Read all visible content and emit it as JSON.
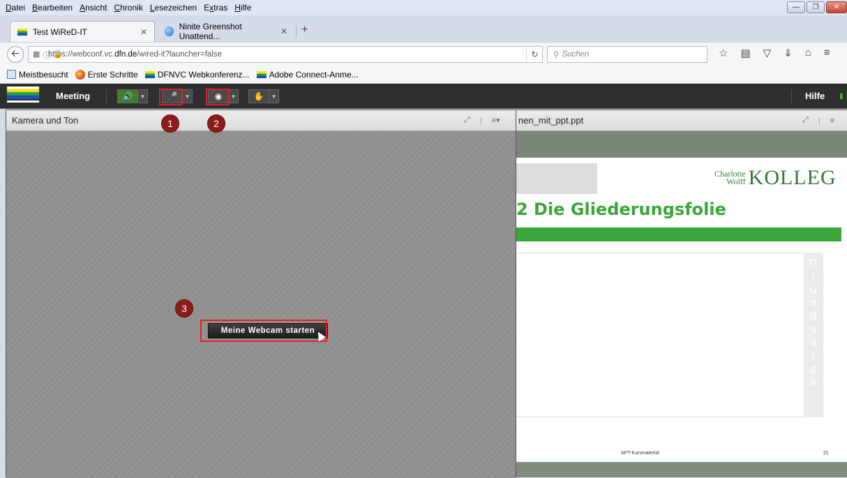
{
  "menu": {
    "items": [
      "Datei",
      "Bearbeiten",
      "Ansicht",
      "Chronik",
      "Lesezeichen",
      "Extras",
      "Hilfe"
    ],
    "accel": [
      "D",
      "B",
      "A",
      "C",
      "L",
      "x",
      "H"
    ]
  },
  "tabs": [
    {
      "label": "Test WiReD-IT",
      "active": true
    },
    {
      "label": "Ninite Greenshot Unattend...",
      "active": false
    }
  ],
  "nav": {
    "url_prefix": "https://webconf.vc.",
    "url_domain": "dfn.de",
    "url_suffix": "/wired-it?launcher=false",
    "search_placeholder": "Suchen"
  },
  "bookmarks": [
    "Meistbesucht",
    "Erste Schritte",
    "DFNVC Webkonferenz...",
    "Adobe Connect-Anme..."
  ],
  "appbar": {
    "meeting_label": "Meeting",
    "help_label": "Hilfe"
  },
  "left_panel": {
    "title": "Kamera und Ton",
    "webcam_button": "Meine Webcam starten"
  },
  "badges": [
    "1",
    "2",
    "3"
  ],
  "right_panel": {
    "title": "nen_mit_ppt.ppt",
    "slide": {
      "logo_small_1": "Charlotte",
      "logo_small_2": "Wolff",
      "logo_big": "KOLLEG",
      "heading": "2  Die Gliederungsfolie",
      "vertical_word": "Grundsätze",
      "footer": "APT-Kursmaterial",
      "page": "21"
    }
  },
  "colors": {
    "highlight": "#e0202a",
    "badge": "#8f1a1a",
    "slide_green": "#3aa63a"
  }
}
